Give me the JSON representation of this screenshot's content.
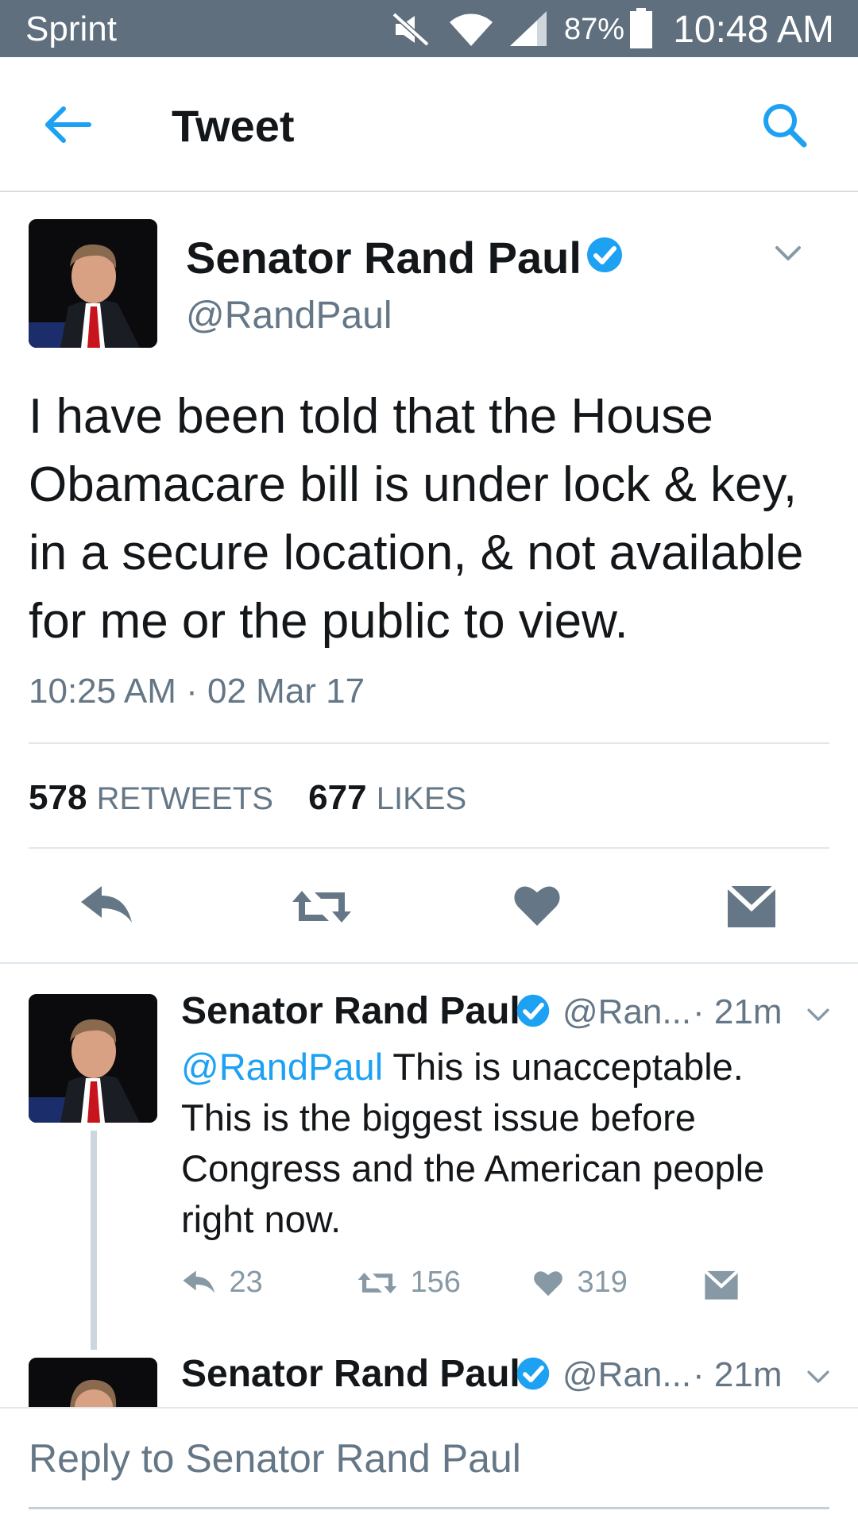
{
  "status_bar": {
    "carrier": "Sprint",
    "battery": "87%",
    "time": "10:48 AM"
  },
  "header": {
    "title": "Tweet"
  },
  "main_tweet": {
    "name": "Senator Rand Paul",
    "handle": "@RandPaul",
    "text_lines": [
      "I have been told that the House",
      "Obamacare bill is under lock & key,",
      "in a secure location, & not available",
      "for me or the public to view."
    ],
    "timestamp": "10:25 AM · 02 Mar 17",
    "retweets_count": "578",
    "retweets_label": "RETWEETS",
    "likes_count": "677",
    "likes_label": "LIKES"
  },
  "replies": [
    {
      "name": "Senator Rand Paul",
      "handle": "@Ran...",
      "time": "· 21m",
      "mention": "@RandPaul",
      "text_first": " This is unacceptable.",
      "text_lines": [
        "This is the biggest issue before",
        "Congress and the American people",
        "right now."
      ],
      "reply_count": "23",
      "retweet_count": "156",
      "like_count": "319"
    },
    {
      "name": "Senator Rand Paul",
      "handle": "@Ran...",
      "time": "· 21m"
    }
  ],
  "composer": {
    "placeholder": "Reply to Senator Rand Paul"
  },
  "colors": {
    "status_bar": "#5f6f7e",
    "accent": "#1da1f2",
    "icon_gray": "#657786",
    "verified": "#1da1f2"
  }
}
